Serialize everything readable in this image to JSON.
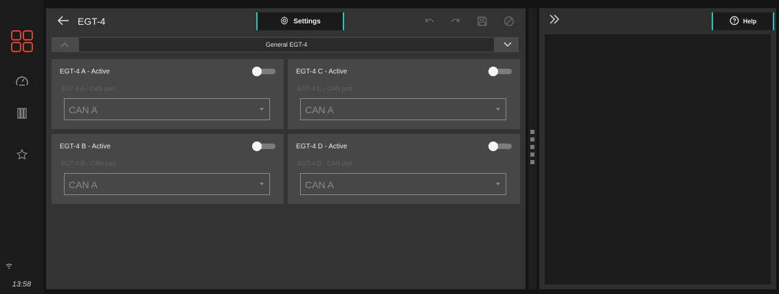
{
  "app": {
    "clock": "13:58"
  },
  "left_rail": {
    "items": [
      {
        "name": "apps-grid-icon",
        "active": true
      },
      {
        "name": "gauge-icon",
        "active": false
      },
      {
        "name": "columns-icon",
        "active": false
      },
      {
        "name": "star-icon",
        "active": false
      }
    ],
    "accent_color": "#e0442a"
  },
  "header": {
    "title": "EGT-4",
    "settings_label": "Settings"
  },
  "section": {
    "title": "General EGT-4"
  },
  "cards": [
    {
      "title": "EGT-4 A - Active",
      "port_label": "EGT-4 A - CAN port",
      "port_value": "CAN A",
      "active": false
    },
    {
      "title": "EGT-4 C - Active",
      "port_label": "EGT-4 C - CAN port",
      "port_value": "CAN A",
      "active": false
    },
    {
      "title": "EGT-4 B - Active",
      "port_label": "EGT-4 B - CAN port",
      "port_value": "CAN A",
      "active": false
    },
    {
      "title": "EGT-4 D - Active",
      "port_label": "EGT-4 D - CAN port",
      "port_value": "CAN A",
      "active": false
    }
  ],
  "help_panel": {
    "help_label": "Help"
  },
  "colors": {
    "tab_accent": "#24c8c0",
    "panel_bg": "#333333",
    "card_bg": "#474747"
  }
}
